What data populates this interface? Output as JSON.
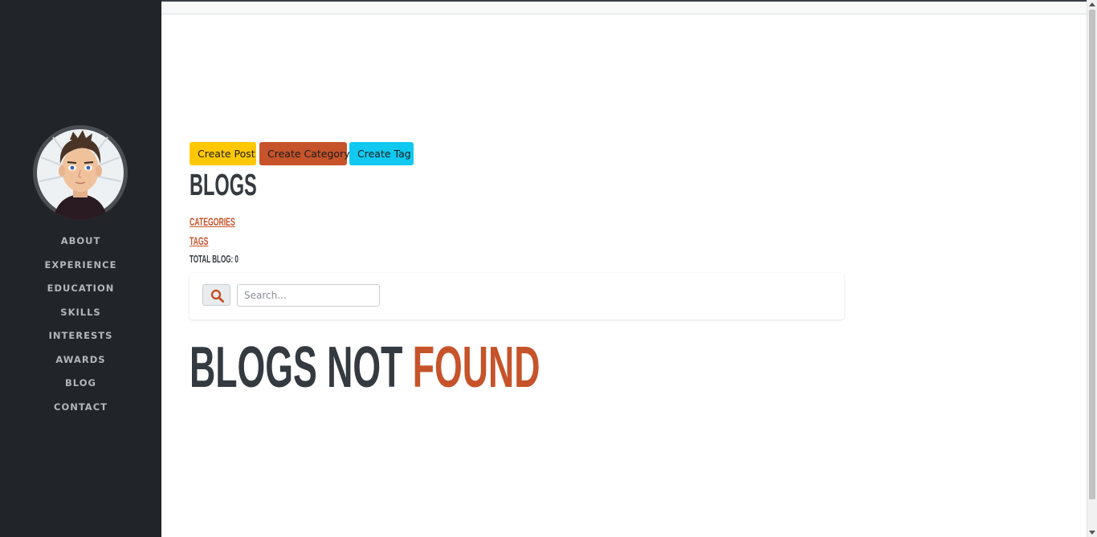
{
  "sidebar": {
    "nav": [
      "ABOUT",
      "EXPERIENCE",
      "EDUCATION",
      "SKILLS",
      "INTERESTS",
      "AWARDS",
      "BLOG",
      "CONTACT"
    ]
  },
  "actions": {
    "create_post": "Create Post",
    "create_category": "Create Category",
    "create_tag": "Create Tag"
  },
  "page": {
    "title": "BLOGS",
    "categories_link": "CATEGORIES",
    "tags_link": "TAGS",
    "total_blog": "TOTAL BLOG: 0"
  },
  "search": {
    "placeholder": "Search..."
  },
  "empty_state": {
    "part1": "BLOGS NOT",
    "part2": "FOUND"
  },
  "colors": {
    "sidebar_bg": "#212529",
    "accent": "#c6532a",
    "yellow": "#ffc800",
    "cyan": "#10c8f0",
    "text_dark": "#343a40"
  }
}
